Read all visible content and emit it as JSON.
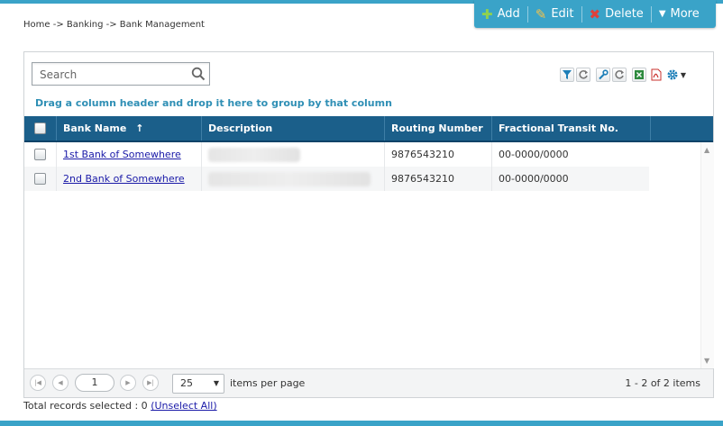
{
  "breadcrumb": "Home -> Banking -> Bank Management",
  "toolbar": {
    "add_label": "Add",
    "edit_label": "Edit",
    "delete_label": "Delete",
    "more_label": "More"
  },
  "search": {
    "placeholder": "Search"
  },
  "grid_icons": [
    "filter-icon",
    "refresh-icon",
    "wrench-icon",
    "refresh-icon",
    "excel-icon",
    "pdf-icon",
    "gear-icon"
  ],
  "group_hint": "Drag a column header and drop it here to group by that column",
  "columns": {
    "bank_name": "Bank Name",
    "description": "Description",
    "routing_number": "Routing Number",
    "fractional_transit": "Fractional Transit No."
  },
  "sort_indicator": "↑",
  "rows": [
    {
      "bank_name": "1st Bank of Somewhere",
      "routing_number": "9876543210",
      "fractional_transit": "00-0000/0000"
    },
    {
      "bank_name": "2nd Bank of Somewhere",
      "routing_number": "9876543210",
      "fractional_transit": "00-0000/0000"
    }
  ],
  "pager": {
    "current_page": "1",
    "page_size": "25",
    "items_per_page_label": "items per page",
    "info": "1 - 2 of 2 items"
  },
  "footer": {
    "selected_label": "Total records selected : 0",
    "unselect_link": "(Unselect All)"
  },
  "colors": {
    "accent": "#3aa3c8",
    "header_bg": "#1b5f8a",
    "link": "#1a1aa8",
    "hint": "#2f8fb5"
  }
}
